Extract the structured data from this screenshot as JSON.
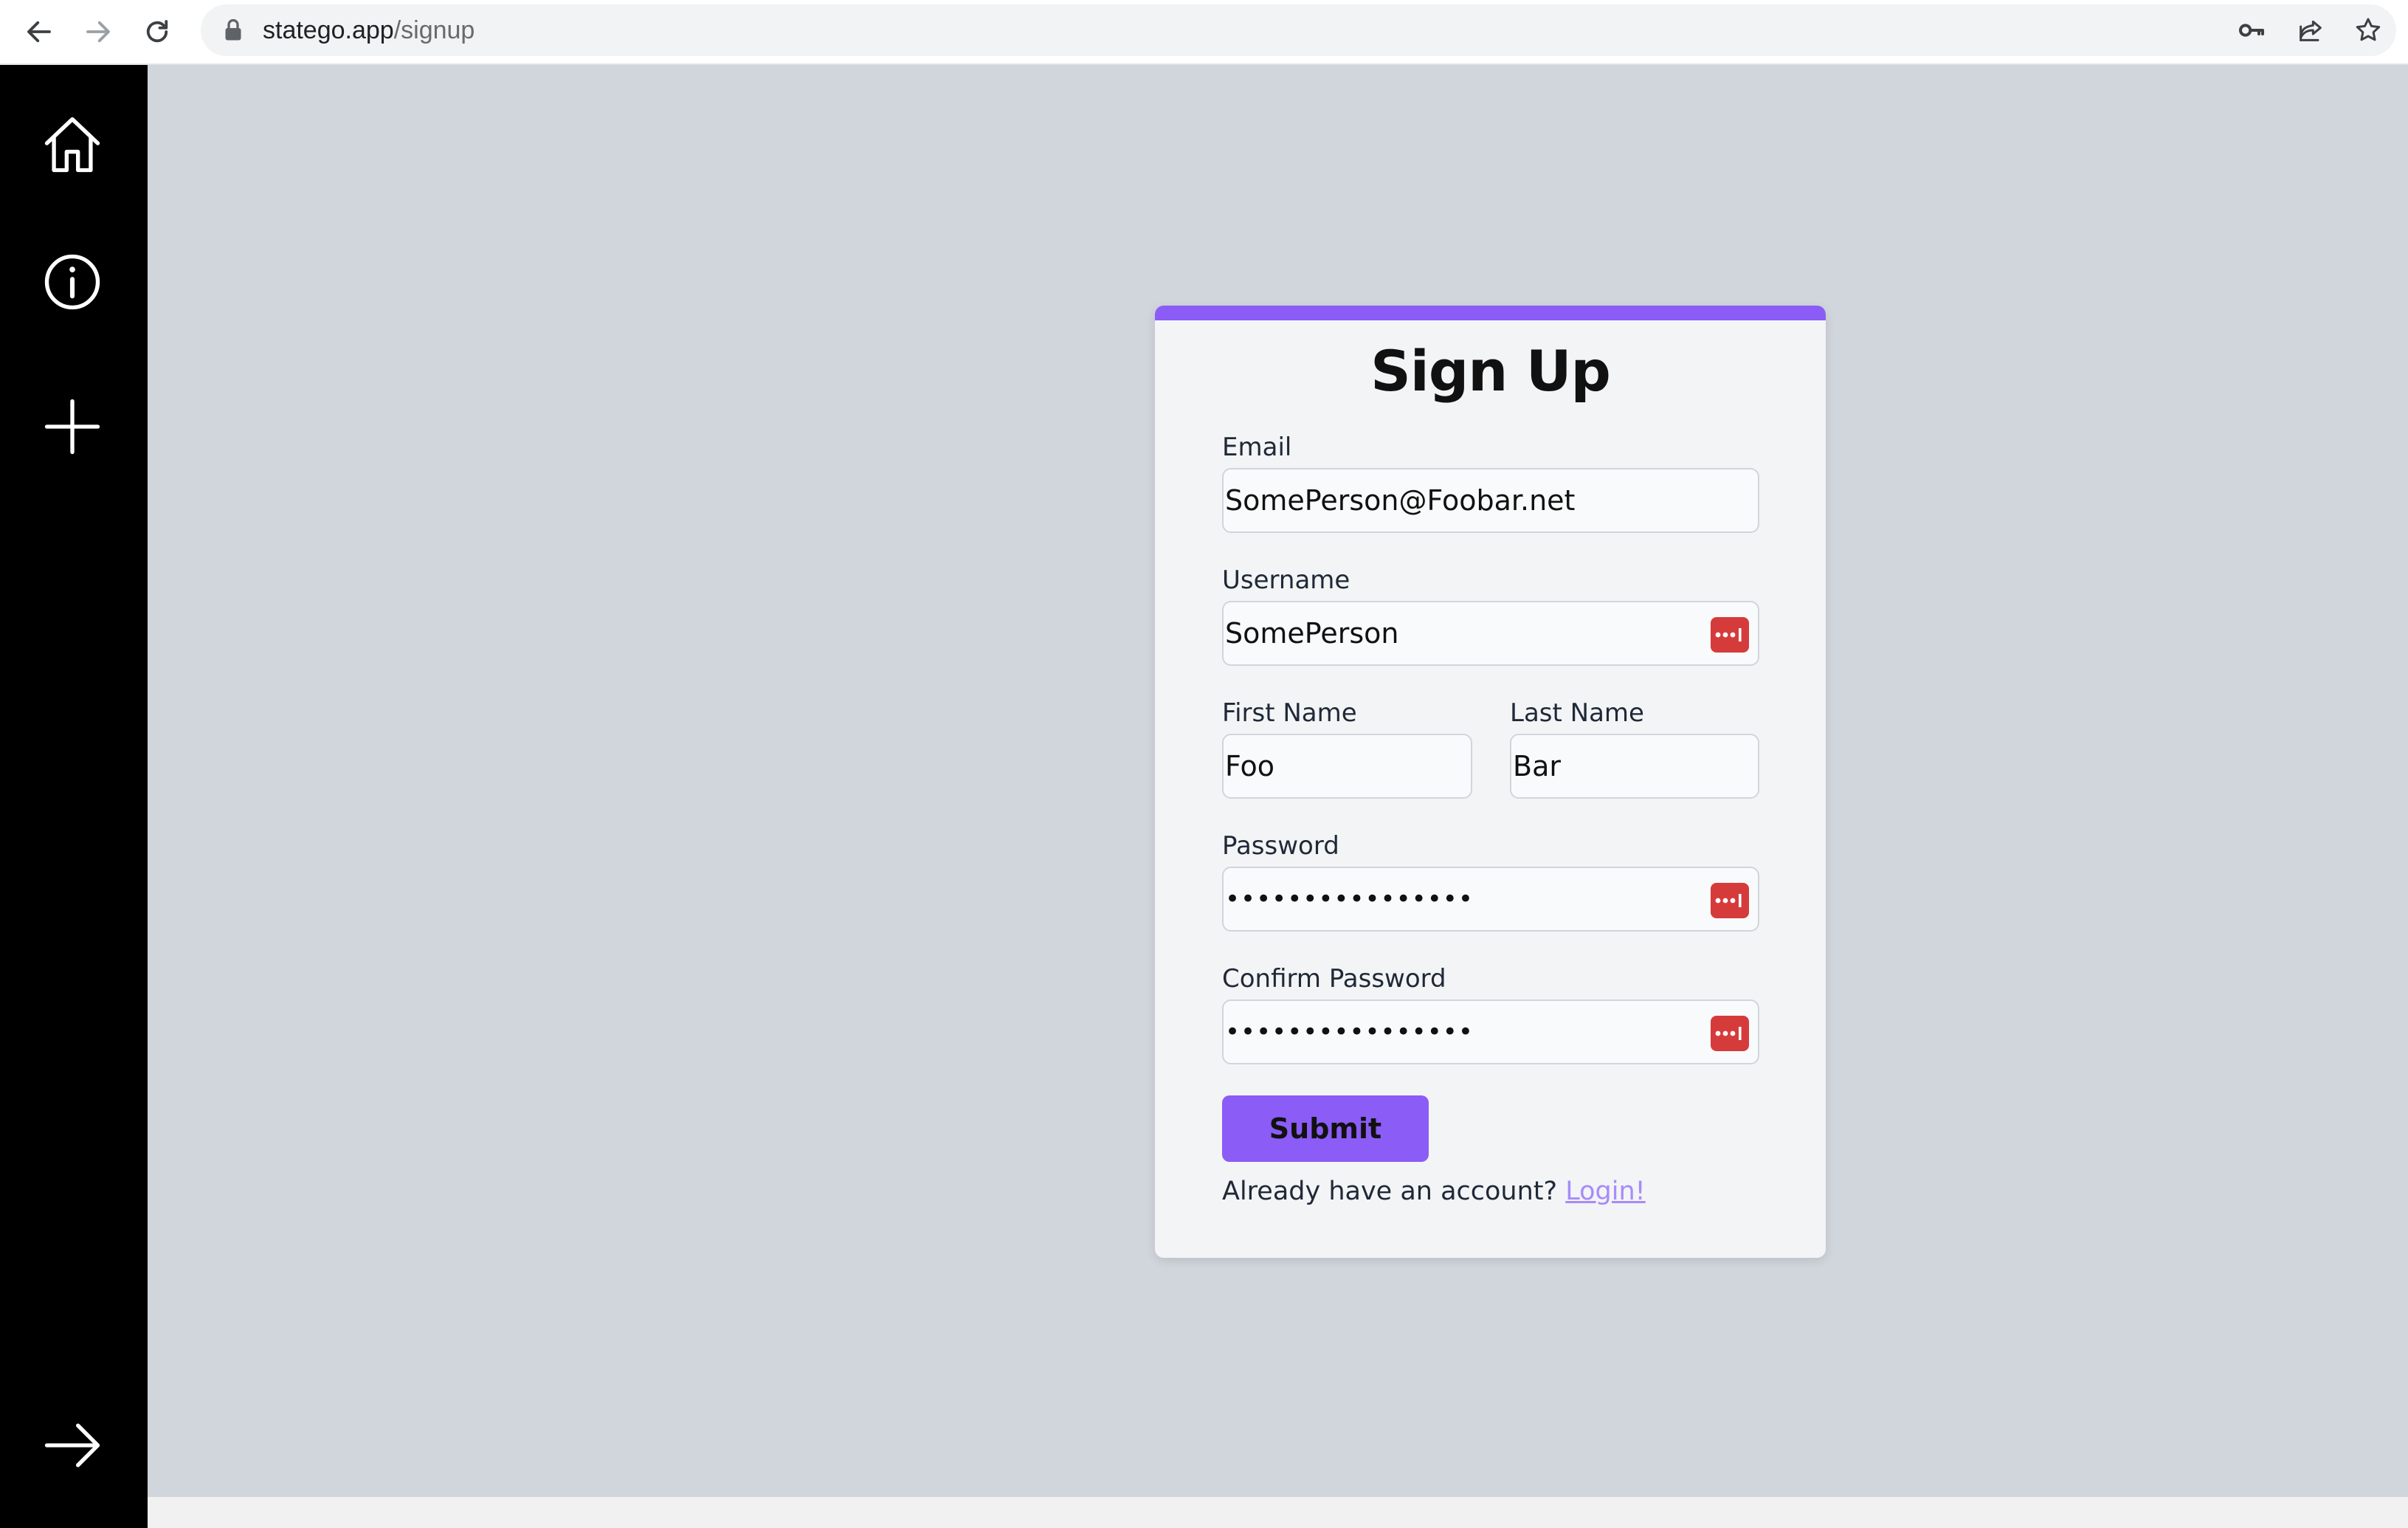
{
  "browser": {
    "url_host": "statego.app",
    "url_path": "/signup"
  },
  "sidebar": {
    "items": [
      {
        "icon": "home-icon"
      },
      {
        "icon": "info-icon"
      },
      {
        "icon": "plus-icon"
      },
      {
        "icon": "arrow-right-icon"
      }
    ]
  },
  "form": {
    "title": "Sign Up",
    "email": {
      "label": "Email",
      "value": "SomePerson@Foobar.net"
    },
    "username": {
      "label": "Username",
      "value": "SomePerson"
    },
    "first_name": {
      "label": "First Name",
      "value": "Foo"
    },
    "last_name": {
      "label": "Last Name",
      "value": "Bar"
    },
    "password": {
      "label": "Password",
      "value": "••••••••••••••••"
    },
    "confirm_password": {
      "label": "Confirm Password",
      "value": "••••••••••••••••"
    },
    "submit_label": "Submit",
    "footer_text": "Already have an account?",
    "login_link": "Login!"
  },
  "colors": {
    "accent": "#8b5cf6",
    "sidebar": "#000000",
    "background": "#d1d5dc",
    "password_manager": "#d63b3b"
  }
}
